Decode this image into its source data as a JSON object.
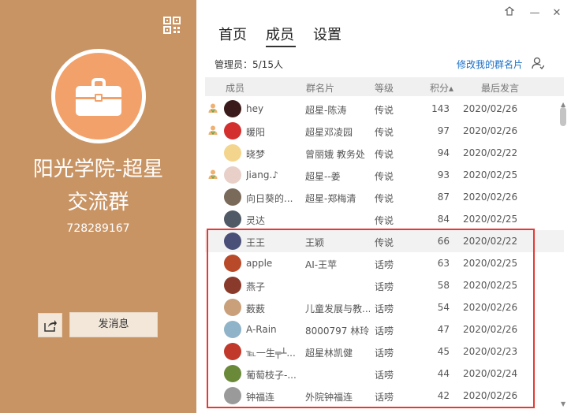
{
  "group": {
    "name_line1": "阳光学院-超星",
    "name_line2": "交流群",
    "id": "728289167",
    "send_label": "发消息"
  },
  "tabs": [
    {
      "label": "首页"
    },
    {
      "label": "成员"
    },
    {
      "label": "设置"
    }
  ],
  "active_tab": "成员",
  "admin_info": "管理员：5/15人",
  "edit_card_label": "修改我的群名片",
  "columns": {
    "member": "成员",
    "card": "群名片",
    "level": "等级",
    "score": "积分▴",
    "last": "最后发言"
  },
  "members": [
    {
      "name": "hey",
      "card": "超星-陈涛",
      "level": "传说",
      "score": "143",
      "date": "2020/02/26",
      "owner": true,
      "avatar_color": "#3a1a1a"
    },
    {
      "name": "暖阳",
      "card": "超星邓凌园",
      "level": "传说",
      "score": "97",
      "date": "2020/02/26",
      "owner": true,
      "avatar_color": "#d32f2f"
    },
    {
      "name": "晓梦",
      "card": "曾丽娥 教务处",
      "level": "传说",
      "score": "94",
      "date": "2020/02/22",
      "owner": false,
      "avatar_color": "#f4d58d"
    },
    {
      "name": "Jiang.♪",
      "card": "超星--姜",
      "level": "传说",
      "score": "93",
      "date": "2020/02/25",
      "owner": true,
      "avatar_color": "#e8d0c8"
    },
    {
      "name": "向日葵的...",
      "card": "超星-郑梅清",
      "level": "传说",
      "score": "87",
      "date": "2020/02/26",
      "owner": false,
      "avatar_color": "#7a6a5a"
    },
    {
      "name": "灵达",
      "card": "",
      "level": "传说",
      "score": "84",
      "date": "2020/02/25",
      "owner": false,
      "avatar_color": "#505a66"
    },
    {
      "name": "王王",
      "card": "王颖",
      "level": "传说",
      "score": "66",
      "date": "2020/02/22",
      "owner": false,
      "avatar_color": "#4a4f78",
      "highlight": true
    },
    {
      "name": "apple",
      "card": "AI-王苹",
      "level": "话唠",
      "score": "63",
      "date": "2020/02/25",
      "owner": false,
      "avatar_color": "#b84a2a"
    },
    {
      "name": "燕子",
      "card": "",
      "level": "话唠",
      "score": "58",
      "date": "2020/02/25",
      "owner": false,
      "avatar_color": "#8a3a2a"
    },
    {
      "name": "薮薮",
      "card": "儿童发展与教...",
      "level": "话唠",
      "score": "54",
      "date": "2020/02/26",
      "owner": false,
      "avatar_color": "#c9a07a"
    },
    {
      "name": "A-Rain",
      "card": "8000797 林玲",
      "level": "话唠",
      "score": "47",
      "date": "2020/02/26",
      "owner": false,
      "avatar_color": "#8fb3c8"
    },
    {
      "name": "℡一生╤┴...",
      "card": "超星林凯健",
      "level": "话唠",
      "score": "45",
      "date": "2020/02/23",
      "owner": false,
      "avatar_color": "#c0392b"
    },
    {
      "name": "葡萄枝子-...",
      "card": "",
      "level": "话唠",
      "score": "44",
      "date": "2020/02/24",
      "owner": false,
      "avatar_color": "#6a8a3a"
    },
    {
      "name": "钟福连",
      "card": "外院钟福连",
      "level": "话唠",
      "score": "42",
      "date": "2020/02/26",
      "owner": false,
      "avatar_color": "#9a9a9a"
    }
  ],
  "colors": {
    "left_panel": "#c99464",
    "avatar_bg": "#f3a16a",
    "link": "#1a6fc6",
    "highlight_border": "#e53935"
  }
}
